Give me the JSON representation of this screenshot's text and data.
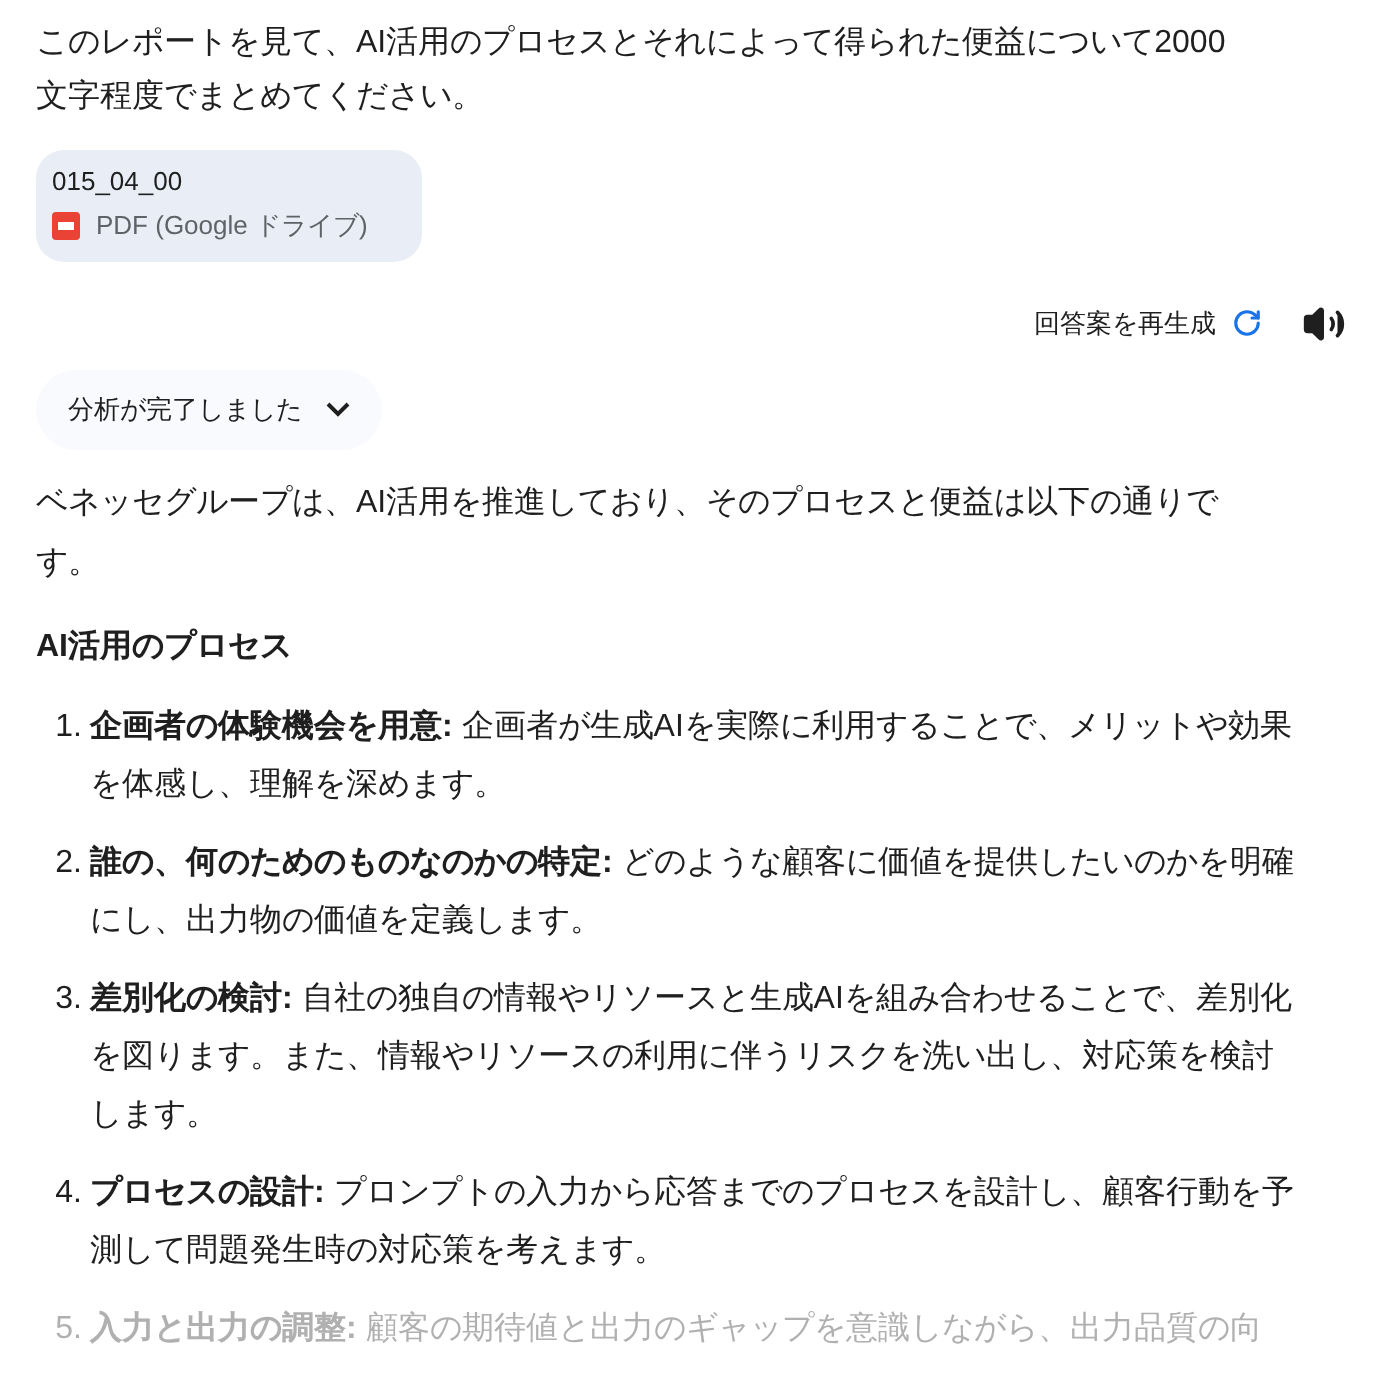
{
  "prompt": "このレポートを見て、AI活用のプロセスとそれによって得られた便益について2000文字程度でまとめてください。",
  "attachment": {
    "name": "015_04_00",
    "type_label": "PDF (Google ドライブ)"
  },
  "regenerate": {
    "label": "回答案を再生成"
  },
  "analysis_chip": {
    "label": "分析が完了しました",
    "expanded": false
  },
  "intro": "ベネッセグループは、AI活用を推進しており、そのプロセスと便益は以下の通りです。",
  "heading": "AI活用のプロセス",
  "steps": [
    {
      "number": "1.",
      "text": "**企画者の体験機会を用意:** 企画者が生成AIを実際に利用することで、メリットや効果を体感し、理解を深めます。",
      "faded": false
    },
    {
      "number": "2.",
      "text": "**誰の、何のためのものなのかの特定:** どのような顧客に価値を提供したいのかを明確にし、出力物の価値を定義します。",
      "faded": false
    },
    {
      "number": "3.",
      "text": "**差別化の検討:** 自社の独自の情報やリソースと生成AIを組み合わせることで、差別化を図ります。また、情報やリソースの利用に伴うリスクを洗い出し、対応策を検討します。",
      "faded": false
    },
    {
      "number": "4.",
      "text": "**プロセスの設計:** プロンプトの入力から応答までのプロセスを設計し、顧客行動を予測して問題発生時の対応策を考えます。",
      "faded": false
    },
    {
      "number": "5.",
      "text": "**入力と出力の調整:** 顧客の期待値と出力のギャップを意識しながら、出力品質の向",
      "faded": true
    }
  ]
}
